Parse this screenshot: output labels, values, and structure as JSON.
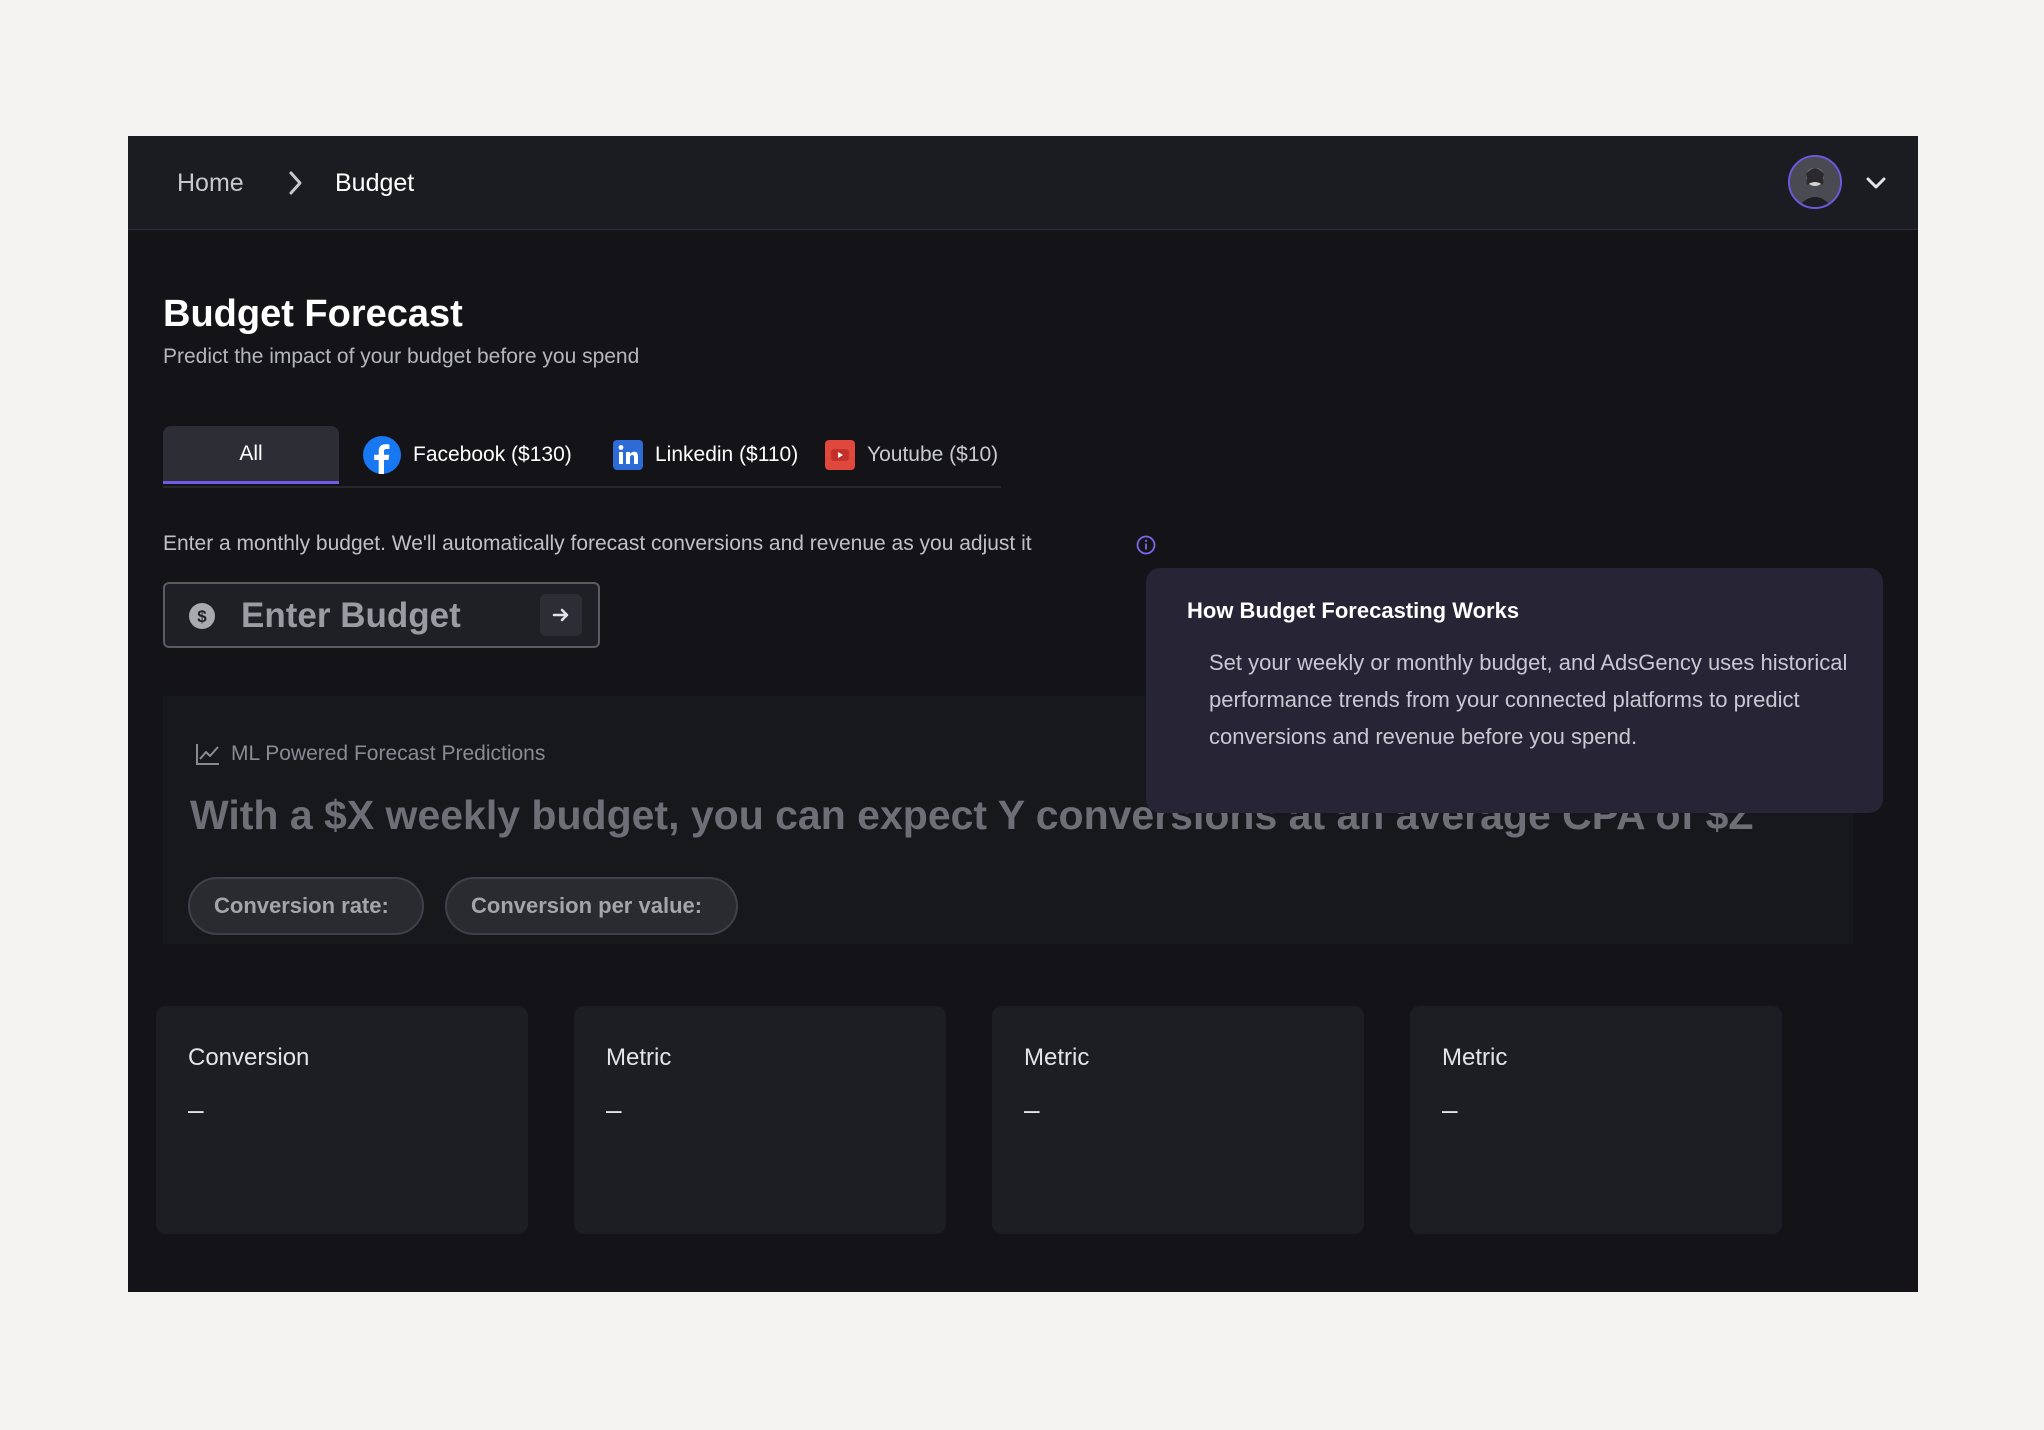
{
  "breadcrumb": {
    "home": "Home",
    "current": "Budget"
  },
  "header": {
    "avatar_icon": "user-avatar",
    "menu_icon": "chevron-down-icon"
  },
  "page": {
    "title": "Budget Forecast",
    "subtitle": "Predict the impact of your budget before you spend"
  },
  "tabs": [
    {
      "label": "All",
      "active": true
    },
    {
      "label": "Facebook ($130)",
      "icon": "facebook-icon"
    },
    {
      "label": "Linkedin ($110)",
      "icon": "linkedin-icon"
    },
    {
      "label": "Youtube ($10)",
      "icon": "youtube-icon"
    }
  ],
  "budget": {
    "hint": "Enter a monthly budget. We'll automatically forecast conversions and revenue as you adjust it",
    "placeholder": "Enter Budget"
  },
  "forecast": {
    "label": "ML Powered Forecast Predictions",
    "headline": "With a $X weekly budget, you can expect Y conversions at an average CPA of $Z",
    "pills": [
      "Conversion rate:",
      "Conversion per value:"
    ]
  },
  "tooltip": {
    "title": "How Budget Forecasting Works",
    "body": "Set your weekly or monthly budget, and AdsGency uses historical performance trends from your connected platforms to predict conversions and revenue before you spend."
  },
  "metrics": [
    {
      "label": "Conversion",
      "value": "–"
    },
    {
      "label": "Metric",
      "value": "–"
    },
    {
      "label": "Metric",
      "value": "–"
    },
    {
      "label": "Metric",
      "value": "–"
    }
  ],
  "colors": {
    "accent": "#6f5ce6",
    "facebook": "#1877f2",
    "linkedin": "#2d6bd6",
    "youtube": "#e0473d"
  }
}
